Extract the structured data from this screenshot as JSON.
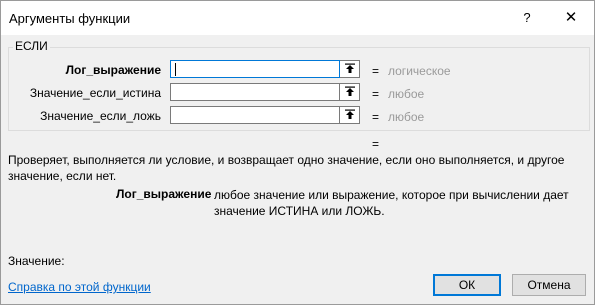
{
  "window": {
    "title": "Аргументы функции",
    "help_glyph": "?",
    "close_glyph": "✕"
  },
  "function_group": {
    "name": "ЕСЛИ",
    "args": [
      {
        "label": "Лог_выражение",
        "value": "",
        "result": "логическое",
        "focused": true
      },
      {
        "label": "Значение_если_истина",
        "value": "",
        "result": "любое",
        "focused": false
      },
      {
        "label": "Значение_если_ложь",
        "value": "",
        "result": "любое",
        "focused": false
      }
    ],
    "equals_sign": "="
  },
  "formula_result_eq": "=",
  "description": "Проверяет, выполняется ли условие, и возвращает одно значение, если оно выполняется, и другое значение, если нет.",
  "arg_help": {
    "name": "Лог_выражение",
    "text": "любое значение или выражение, которое при вычислении дает значение ИСТИНА или ЛОЖЬ."
  },
  "value_label": "Значение:",
  "help_link": "Справка по этой функции",
  "buttons": {
    "ok": "ОК",
    "cancel": "Отмена"
  }
}
